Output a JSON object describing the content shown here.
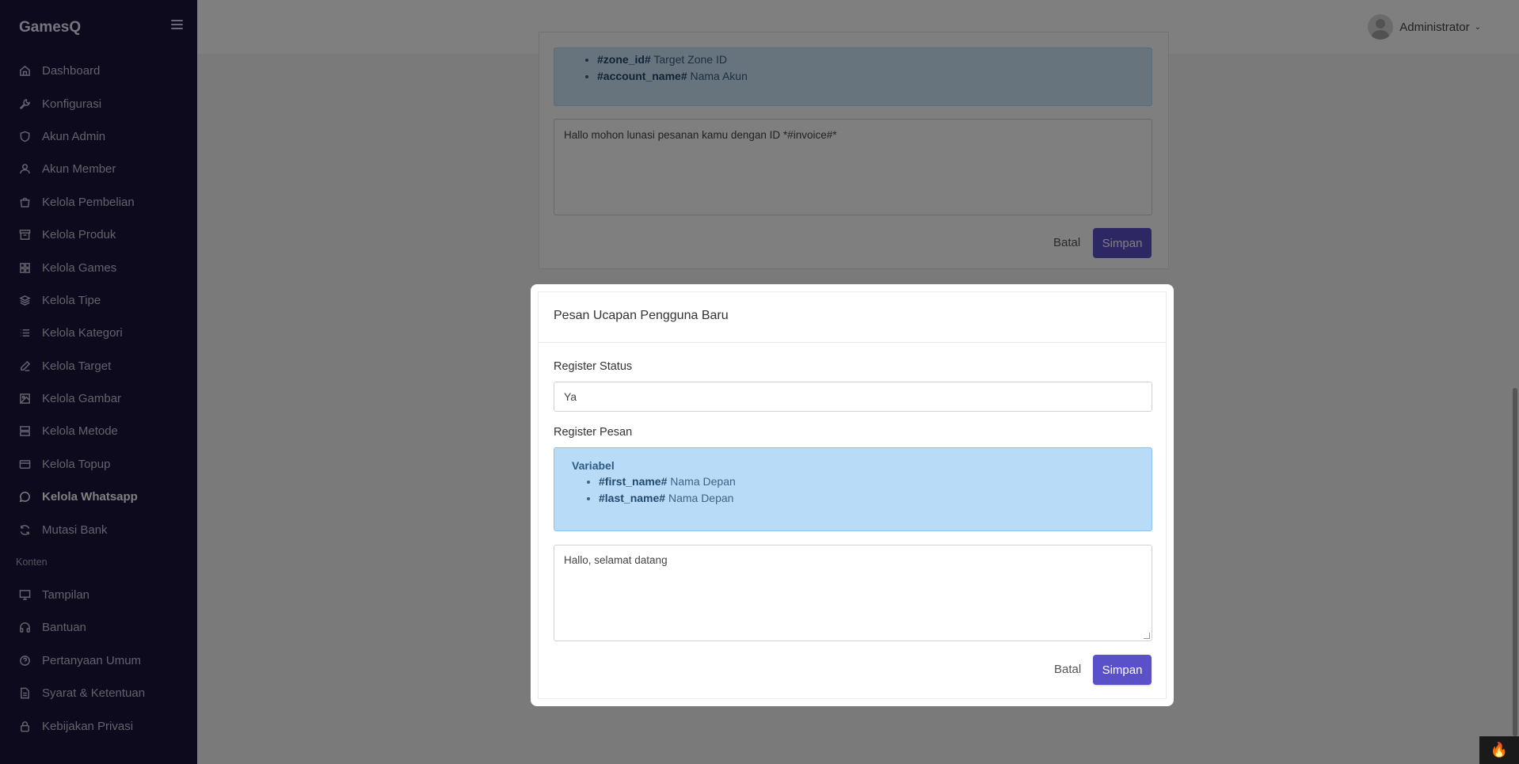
{
  "app": {
    "brand": "GamesQ"
  },
  "header": {
    "user_name": "Administrator"
  },
  "sidebar": {
    "items": [
      {
        "label": "Dashboard",
        "icon": "home-icon"
      },
      {
        "label": "Konfigurasi",
        "icon": "wrench-icon"
      },
      {
        "label": "Akun Admin",
        "icon": "shield-icon"
      },
      {
        "label": "Akun Member",
        "icon": "user-icon"
      },
      {
        "label": "Kelola Pembelian",
        "icon": "bag-icon"
      },
      {
        "label": "Kelola Produk",
        "icon": "archive-icon"
      },
      {
        "label": "Kelola Games",
        "icon": "grid-icon"
      },
      {
        "label": "Kelola Tipe",
        "icon": "layers-icon"
      },
      {
        "label": "Kelola Kategori",
        "icon": "list-icon"
      },
      {
        "label": "Kelola Target",
        "icon": "pen-icon"
      },
      {
        "label": "Kelola Gambar",
        "icon": "image-icon"
      },
      {
        "label": "Kelola Metode",
        "icon": "server-icon"
      },
      {
        "label": "Kelola Topup",
        "icon": "credit-card-icon"
      },
      {
        "label": "Kelola Whatsapp",
        "icon": "chat-icon",
        "active": true
      },
      {
        "label": "Mutasi Bank",
        "icon": "refresh-icon"
      }
    ],
    "section_heading": "Konten",
    "content_items": [
      {
        "label": "Tampilan",
        "icon": "monitor-icon"
      },
      {
        "label": "Bantuan",
        "icon": "headphones-icon"
      },
      {
        "label": "Pertanyaan Umum",
        "icon": "help-circle-icon"
      },
      {
        "label": "Syarat & Ketentuan",
        "icon": "file-icon"
      },
      {
        "label": "Kebijakan Privasi",
        "icon": "lock-icon"
      }
    ]
  },
  "background_card": {
    "variables": [
      {
        "name": "#zone_id#",
        "desc": "Target Zone ID"
      },
      {
        "name": "#account_name#",
        "desc": "Nama Akun"
      }
    ],
    "message": "Hallo mohon lunasi pesanan kamu dengan ID *#invoice#*",
    "cancel_label": "Batal",
    "save_label": "Simpan"
  },
  "modal": {
    "title": "Pesan Ucapan Pengguna Baru",
    "status_label": "Register Status",
    "status_value": "Ya",
    "message_label": "Register Pesan",
    "variables_title": "Variabel",
    "variables": [
      {
        "name": "#first_name#",
        "desc": "Nama Depan"
      },
      {
        "name": "#last_name#",
        "desc": "Nama Depan"
      }
    ],
    "message_value": "Hallo, selamat datang",
    "cancel_label": "Batal",
    "save_label": "Simpan"
  },
  "colors": {
    "sidebar_bg": "#181439",
    "primary": "#5a50c8",
    "info_bg": "#b8dcf7"
  }
}
